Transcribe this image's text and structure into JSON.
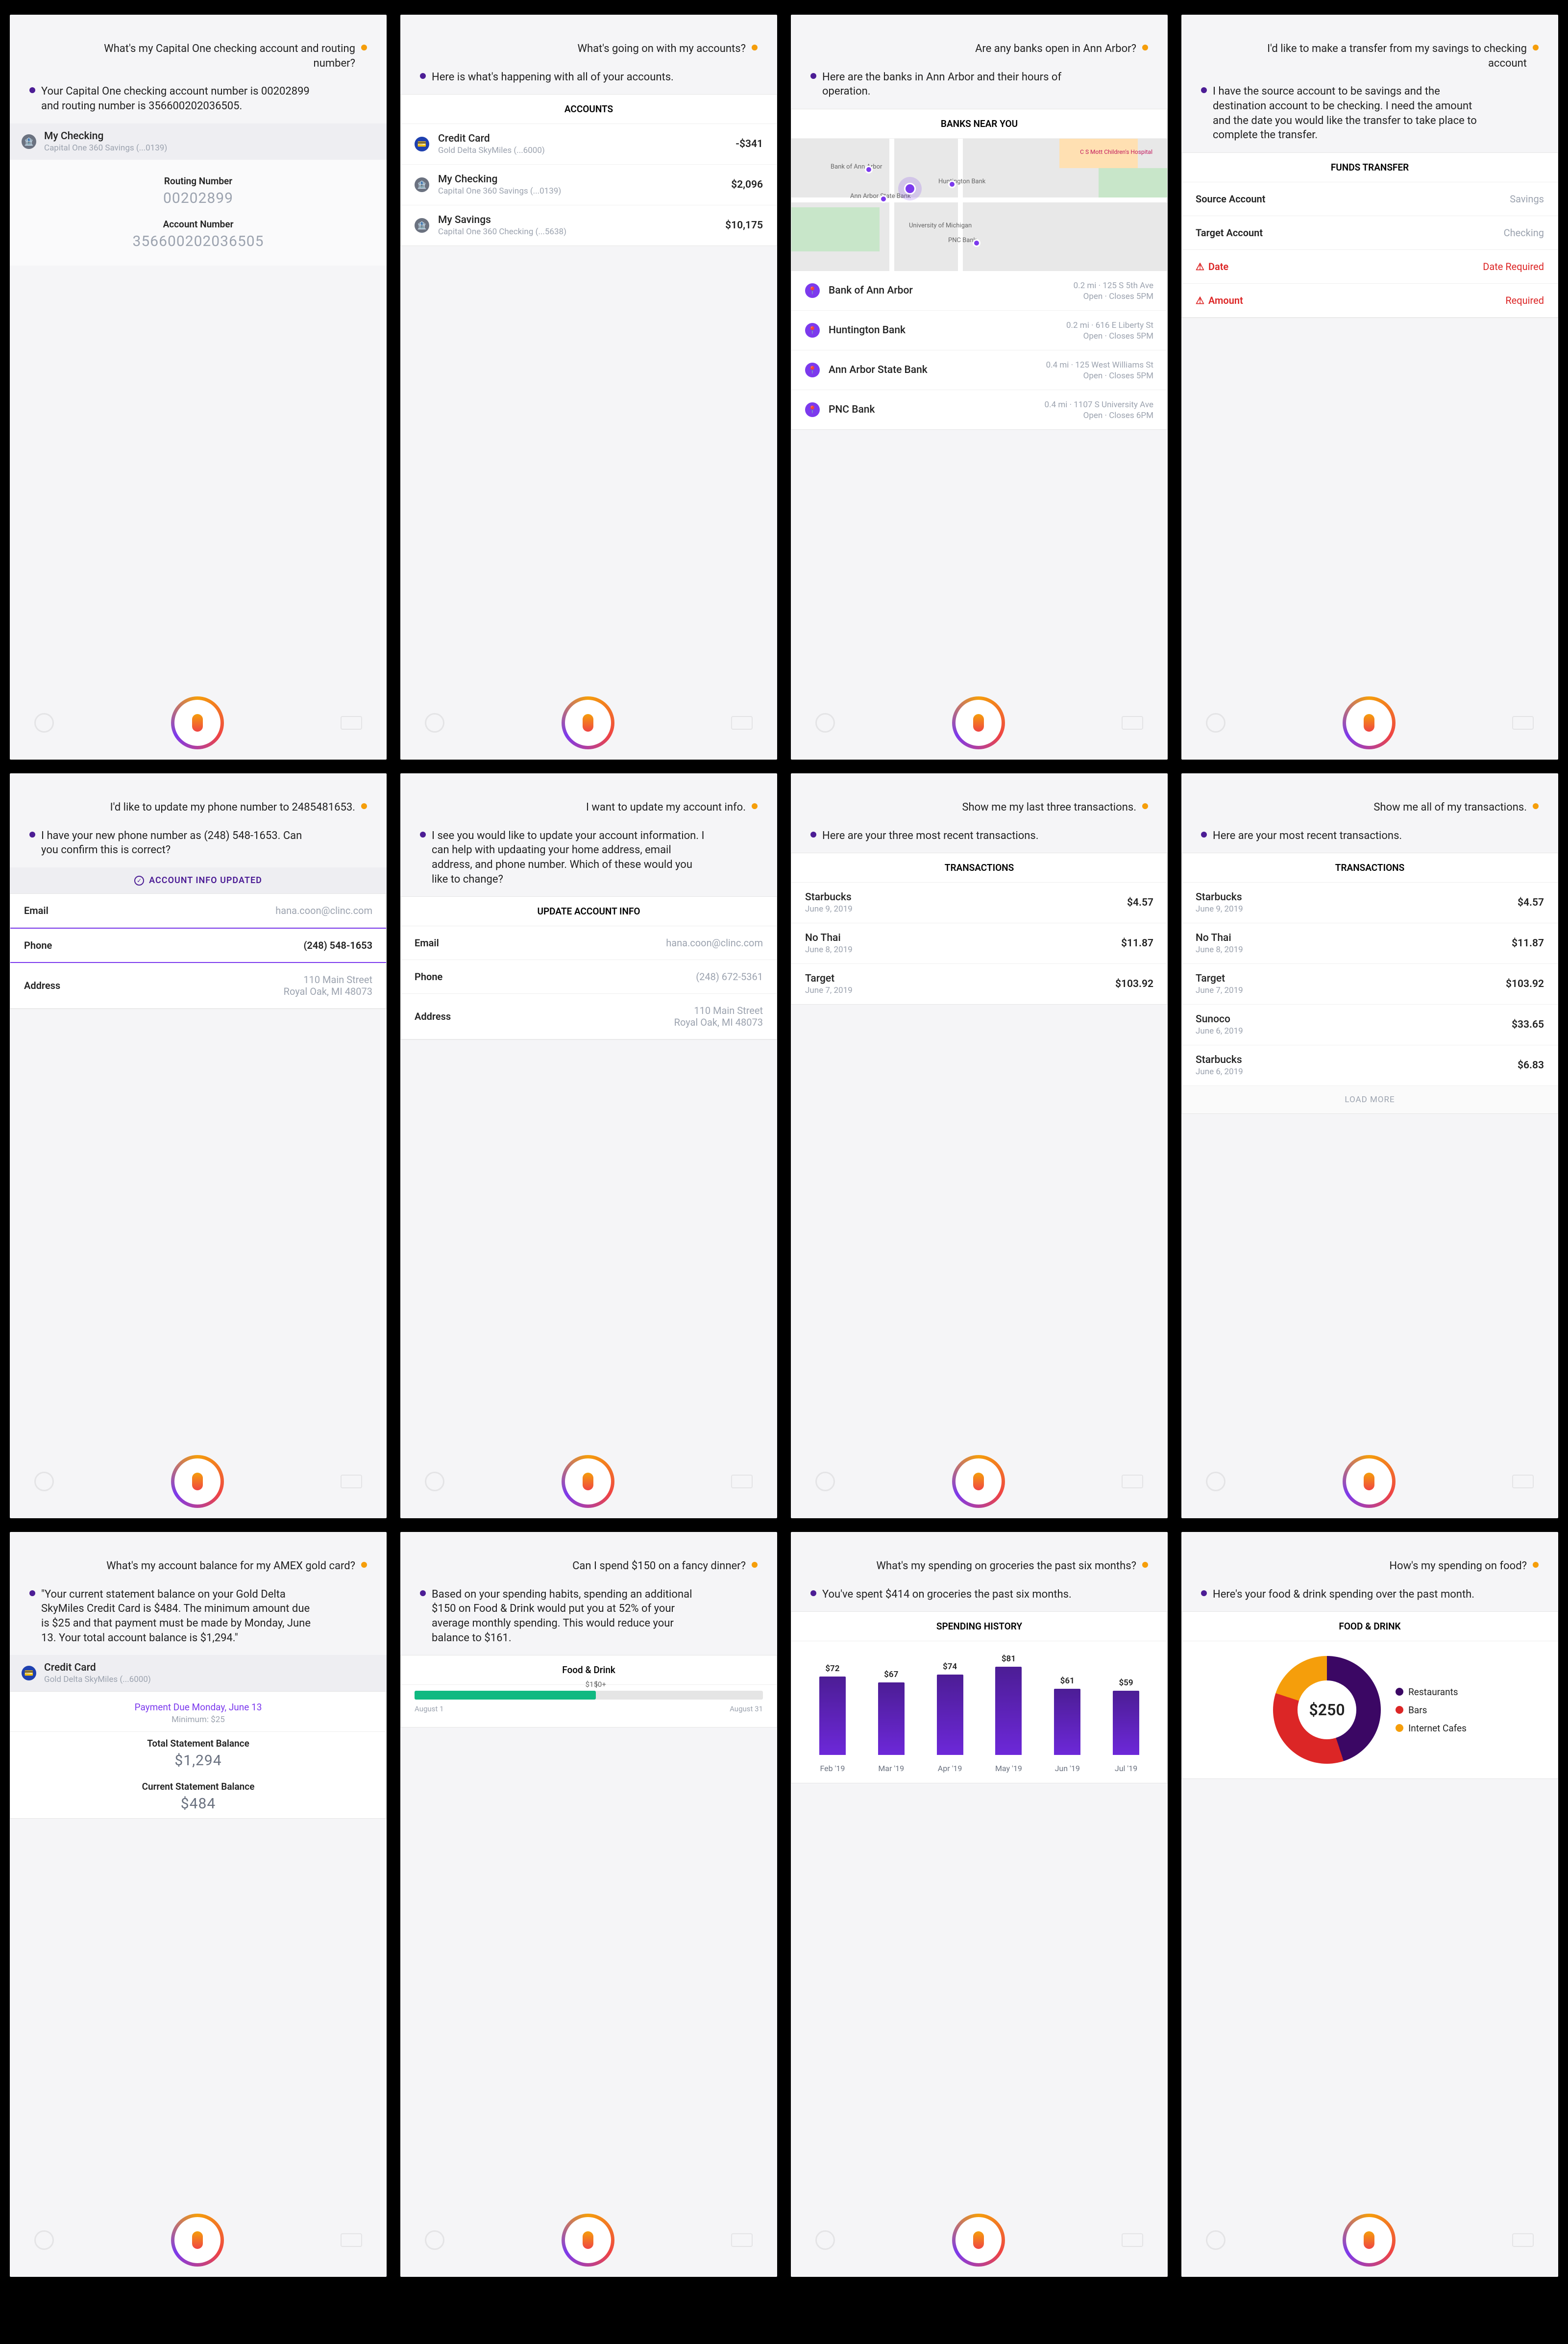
{
  "screen1": {
    "q": "What's my Capital One checking account and routing number?",
    "a": "Your Capital One checking account number is 00202899 and routing number is 356600202036505.",
    "account_name": "My Checking",
    "account_sub": "Capital One 360 Savings (...0139)",
    "routing_label": "Routing Number",
    "routing_value": "00202899",
    "acctnum_label": "Account Number",
    "acctnum_value": "356600202036505"
  },
  "screen2": {
    "q": "What's going on with my accounts?",
    "a": "Here is what's happening with all of your accounts.",
    "title": "ACCOUNTS",
    "rows": [
      {
        "name": "Credit Card",
        "sub": "Gold Delta SkyMiles (...6000)",
        "val": "-$341"
      },
      {
        "name": "My Checking",
        "sub": "Capital One 360 Savings (...0139)",
        "val": "$2,096"
      },
      {
        "name": "My Savings",
        "sub": "Capital One 360 Checking (...5638)",
        "val": "$10,175"
      }
    ]
  },
  "screen3": {
    "q": "Are any banks open in Ann Arbor?",
    "a": "Here are the banks in Ann Arbor and their hours of operation.",
    "title": "BANKS NEAR YOU",
    "banks": [
      {
        "name": "Bank of Ann Arbor",
        "dist": "0.2 mi · 125 S 5th Ave",
        "hours": "Open · Closes 5PM"
      },
      {
        "name": "Huntington Bank",
        "dist": "0.2 mi · 616 E Liberty St",
        "hours": "Open · Closes 5PM"
      },
      {
        "name": "Ann Arbor State Bank",
        "dist": "0.4 mi · 125 West Williams St",
        "hours": "Open · Closes 5PM"
      },
      {
        "name": "PNC Bank",
        "dist": "0.4 mi · 1107 S University Ave",
        "hours": "Open · Closes 6PM"
      }
    ],
    "map_labels": {
      "b1": "Bank of Ann Arbor",
      "b2": "Huntington Bank",
      "b3": "Ann Arbor State Bank",
      "b4": "PNC Bank",
      "uni": "University of Michigan",
      "hosp": "C S Mott Children's Hospital"
    }
  },
  "screen4": {
    "q": "I'd like to make a transfer from my savings to checking account",
    "a": "I have the source account to be savings and the destination account to be checking. I need the amount and the date you would like the transfer to take place to complete the transfer.",
    "title": "FUNDS TRANSFER",
    "src_label": "Source Account",
    "src_val": "Savings",
    "tgt_label": "Target Account",
    "tgt_val": "Checking",
    "date_label": "Date",
    "date_val": "Date Required",
    "amt_label": "Amount",
    "amt_val": "Required"
  },
  "screen5": {
    "q": "I'd like to update my phone number to 2485481653.",
    "a": "I have your new phone number as (248) 548-1653. Can you confirm this is correct?",
    "badge": "ACCOUNT INFO UPDATED",
    "email_l": "Email",
    "email_v": "hana.coon@clinc.com",
    "phone_l": "Phone",
    "phone_v": "(248) 548-1653",
    "addr_l": "Address",
    "addr_v1": "110 Main Street",
    "addr_v2": "Royal Oak, MI 48073"
  },
  "screen6": {
    "q": "I want to update my account info.",
    "a": "I see you would like to update your account information. I can help with updaating your home address, email address, and phone number. Which of these would you like to change?",
    "title": "UPDATE ACCOUNT INFO",
    "email_l": "Email",
    "email_v": "hana.coon@clinc.com",
    "phone_l": "Phone",
    "phone_v": "(248) 672-5361",
    "addr_l": "Address",
    "addr_v1": "110 Main Street",
    "addr_v2": "Royal Oak, MI 48073"
  },
  "screen7": {
    "q": "Show me my last three transactions.",
    "a": "Here are your three most recent transactions.",
    "title": "TRANSACTIONS",
    "tx": [
      {
        "name": "Starbucks",
        "date": "June 9, 2019",
        "val": "$4.57"
      },
      {
        "name": "No Thai",
        "date": "June 8, 2019",
        "val": "$11.87"
      },
      {
        "name": "Target",
        "date": "June 7, 2019",
        "val": "$103.92"
      }
    ]
  },
  "screen8": {
    "q": "Show me all of my transactions.",
    "a": "Here are your most recent transactions.",
    "title": "TRANSACTIONS",
    "tx": [
      {
        "name": "Starbucks",
        "date": "June 9, 2019",
        "val": "$4.57"
      },
      {
        "name": "No Thai",
        "date": "June 8, 2019",
        "val": "$11.87"
      },
      {
        "name": "Target",
        "date": "June 7, 2019",
        "val": "$103.92"
      },
      {
        "name": "Sunoco",
        "date": "June 6, 2019",
        "val": "$33.65"
      },
      {
        "name": "Starbucks",
        "date": "June 6, 2019",
        "val": "$6.83"
      }
    ],
    "load_more": "LOAD MORE"
  },
  "screen9": {
    "q": "What's my account balance for my AMEX gold card?",
    "a": "\"Your current statement balance on your Gold Delta SkyMiles Credit Card is $484. The minimum amount due is $25 and that payment must be made by Monday, June 13. Your total account balance is $1,294.\"",
    "card_name": "Credit Card",
    "card_sub": "Gold Delta SkyMiles (...6000)",
    "pay_note": "Payment Due Monday, June 13",
    "pay_min": "Minimum: $25",
    "tsb_l": "Total Statement Balance",
    "tsb_v": "$1,294",
    "csb_l": "Current Statement Balance",
    "csb_v": "$484"
  },
  "screen10": {
    "q": "Can I spend $150 on a fancy dinner?",
    "a": "Based on your spending habits, spending an additional $150 on Food & Drink would put you at 52% of your average monthly spending. This would reduce your balance to $161.",
    "title": "Food & Drink",
    "marker": "$150+",
    "left": "August 1",
    "right": "August 31",
    "pct": 52
  },
  "screen11": {
    "q": "What's my spending on groceries the past six months?",
    "a": "You've spent $414 on groceries the past six months.",
    "title": "SPENDING HISTORY"
  },
  "screen12": {
    "q": "How's my spending on food?",
    "a": "Here's your food & drink spending over the past month.",
    "title": "FOOD & DRINK",
    "center": "$250",
    "legend": [
      {
        "name": "Restaurants",
        "color": "#3b0764"
      },
      {
        "name": "Bars",
        "color": "#dc2626"
      },
      {
        "name": "Internet Cafes",
        "color": "#f59e0b"
      }
    ]
  },
  "chart_data": [
    {
      "type": "bar",
      "screen": 11,
      "title": "SPENDING HISTORY",
      "categories": [
        "Feb '19",
        "Mar '19",
        "Apr '19",
        "May '19",
        "Jun '19",
        "Jul '19"
      ],
      "values": [
        72,
        67,
        74,
        81,
        61,
        59
      ],
      "xlabel": "",
      "ylabel": "",
      "ylim": [
        0,
        100
      ]
    },
    {
      "type": "pie",
      "screen": 12,
      "title": "FOOD & DRINK",
      "series": [
        {
          "name": "Restaurants",
          "value": 45
        },
        {
          "name": "Bars",
          "value": 35
        },
        {
          "name": "Internet Cafes",
          "value": 20
        }
      ],
      "center_label": "$250"
    },
    {
      "type": "bar",
      "screen": 10,
      "title": "Food & Drink",
      "categories": [
        "August 1",
        "August 31"
      ],
      "values": [
        52
      ],
      "annotation": "$150+",
      "ylim": [
        0,
        100
      ]
    }
  ]
}
